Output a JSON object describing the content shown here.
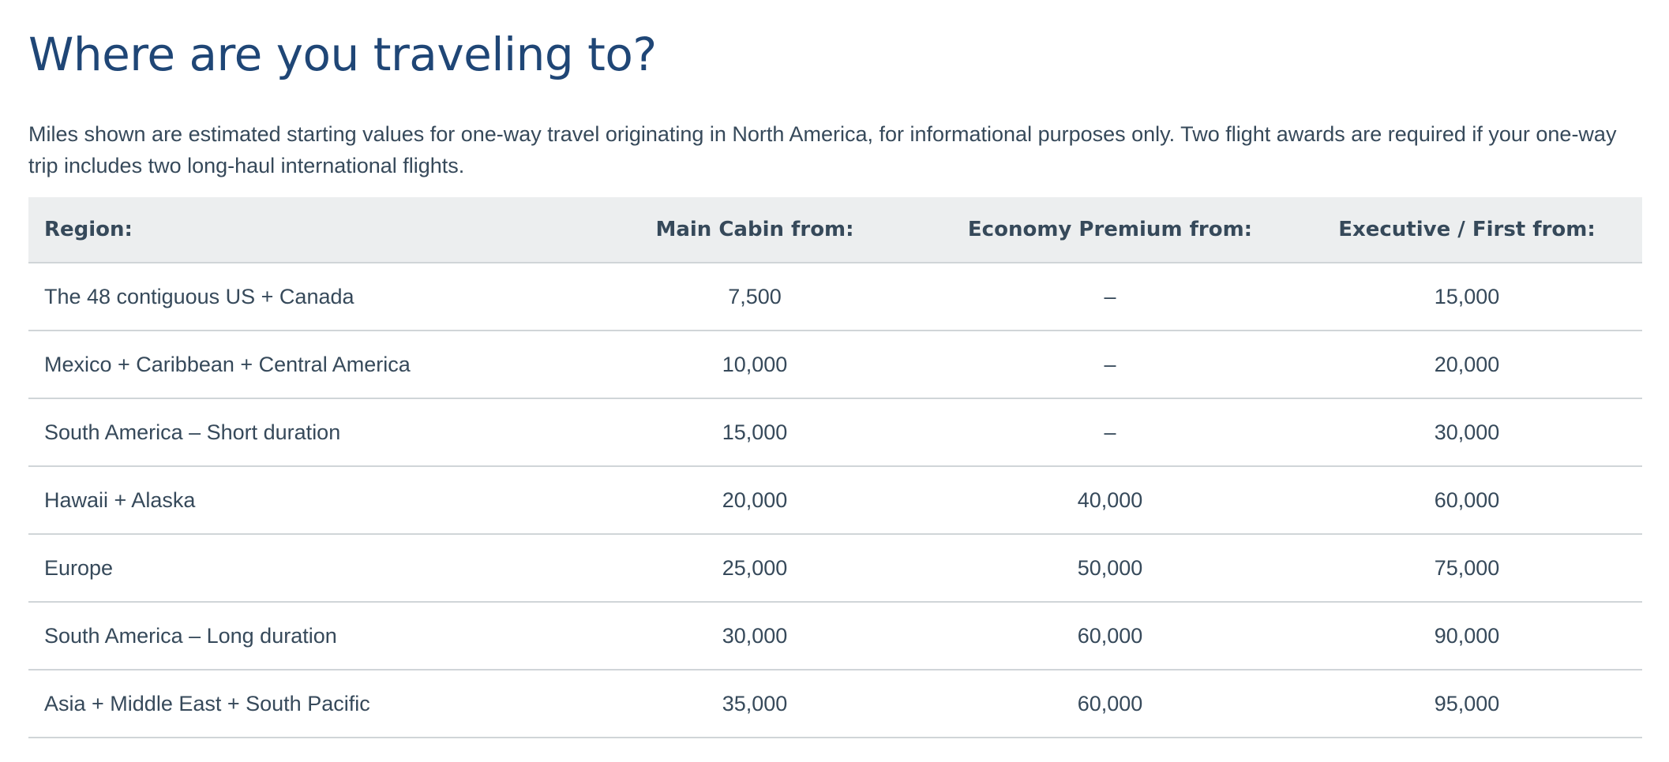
{
  "page": {
    "title": "Where are you traveling to?",
    "intro": "Miles shown are estimated starting values for one-way travel originating in North America, for informational purposes only. Two flight awards are required if your one-way trip includes two long-haul international flights."
  },
  "table": {
    "headers": {
      "region": "Region:",
      "main_cabin": "Main Cabin from:",
      "economy_premium": "Economy Premium from:",
      "executive_first": "Executive / First from:"
    },
    "rows": [
      {
        "region": "The 48 contiguous US + Canada",
        "main_cabin": "7,500",
        "economy_premium": "–",
        "executive_first": "15,000"
      },
      {
        "region": "Mexico + Caribbean + Central America",
        "main_cabin": "10,000",
        "economy_premium": "–",
        "executive_first": "20,000"
      },
      {
        "region": "South America – Short duration",
        "main_cabin": "15,000",
        "economy_premium": "–",
        "executive_first": "30,000"
      },
      {
        "region": "Hawaii + Alaska",
        "main_cabin": "20,000",
        "economy_premium": "40,000",
        "executive_first": "60,000"
      },
      {
        "region": "Europe",
        "main_cabin": "25,000",
        "economy_premium": "50,000",
        "executive_first": "75,000"
      },
      {
        "region": "South America – Long duration",
        "main_cabin": "30,000",
        "economy_premium": "60,000",
        "executive_first": "90,000"
      },
      {
        "region": "Asia + Middle East + South Pacific",
        "main_cabin": "35,000",
        "economy_premium": "60,000",
        "executive_first": "95,000"
      }
    ]
  },
  "colors": {
    "title": "#1f4676",
    "text": "#36495a",
    "header_bg": "#eceeef",
    "divider": "#d0d5d8"
  }
}
